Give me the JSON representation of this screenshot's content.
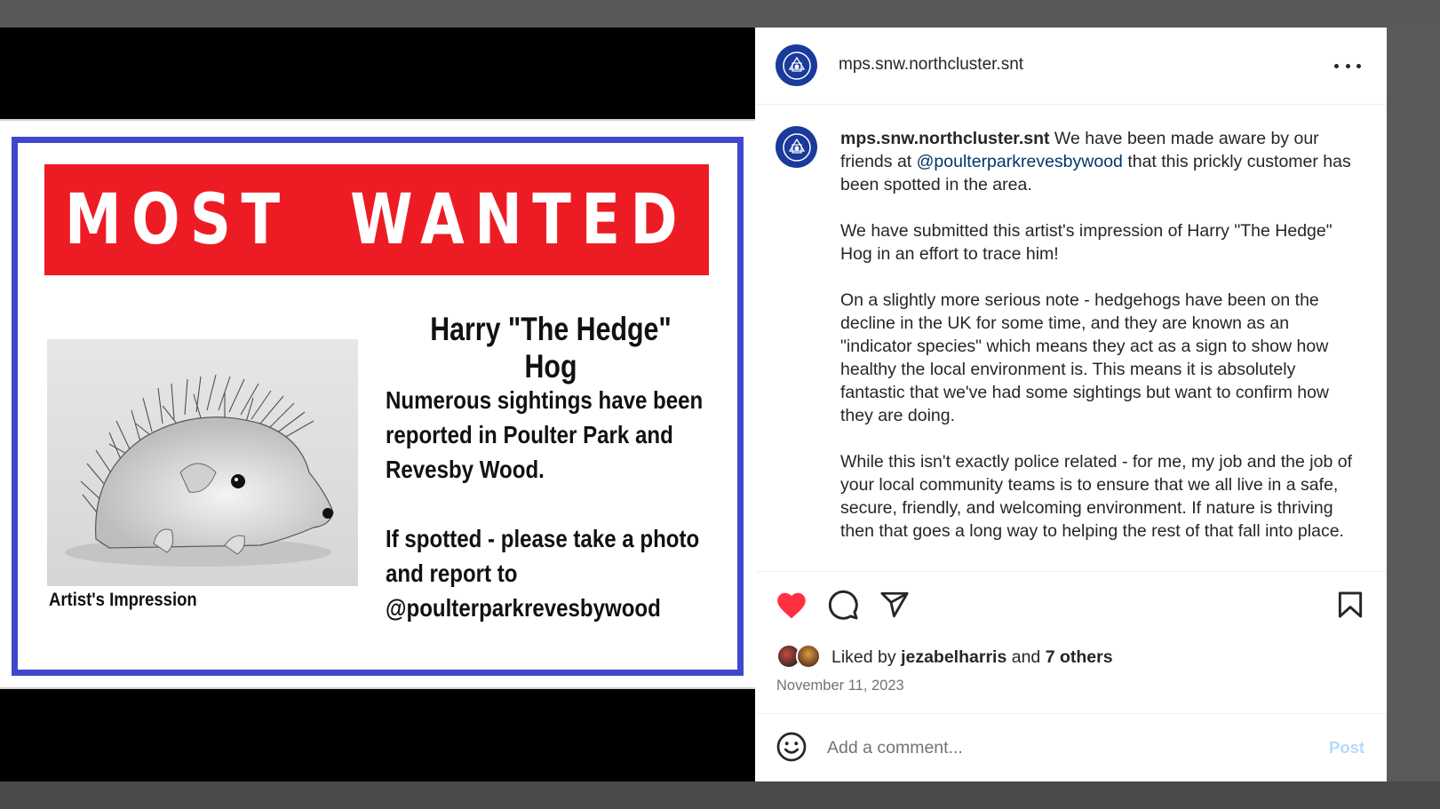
{
  "poster": {
    "banner": "MOST  WANTED",
    "title": "Harry \"The Hedge\" Hog",
    "body_1": "Numerous sightings have been\nreported in Poulter Park and\nRevesby Wood.",
    "body_2": "If spotted - please take a photo\nand report to\n@poulterparkrevesbywood",
    "image_caption": "Artist's Impression",
    "colors": {
      "banner": "#ed1c24",
      "frame": "#3f48cc"
    }
  },
  "post": {
    "username": "mps.snw.northcluster.snt",
    "caption_intro": "We have been made aware by our friends at",
    "caption_mention": "@poulterparkrevesbywood",
    "caption_intro_end": "that this prickly customer has been spotted in the area.",
    "paragraphs": [
      "We have submitted this artist's impression of Harry \"The Hedge\" Hog in an effort to trace him!",
      "On a slightly more serious note - hedgehogs have been on the decline in the UK for some time, and they are known as an \"indicator species\" which means they act as a sign to show how healthy the local environment is. This means it is absolutely fantastic that we've had some sightings but want to confirm how they are doing.",
      "While this isn't exactly police related - for me, my job and the job of your local community teams is to ensure that we all live in a safe, secure, friendly, and welcoming environment. If nature is thriving then that goes a long way to helping the rest of that fall into place."
    ],
    "likes": {
      "prefix": "Liked by",
      "user": "jezabelharris",
      "joiner": "and",
      "others": "7 others"
    },
    "date": "November 11, 2023"
  },
  "comment": {
    "placeholder": "Add a comment...",
    "post_label": "Post"
  },
  "icons": [
    "more-options-icon",
    "heart-icon",
    "comment-icon",
    "share-icon",
    "bookmark-icon",
    "emoji-icon"
  ],
  "colors": {
    "like": "#ff3040",
    "accent": "#0095f6",
    "mention": "#00376b"
  }
}
